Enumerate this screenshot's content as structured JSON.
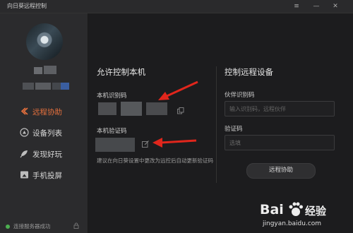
{
  "window": {
    "title": "向日葵远程控制",
    "controls": [
      "≡",
      "—",
      "✕"
    ]
  },
  "sidebar": {
    "items": [
      {
        "label": "远程协助",
        "icon": "remote-assist-icon",
        "active": true
      },
      {
        "label": "设备列表",
        "icon": "device-list-icon",
        "active": false
      },
      {
        "label": "发现好玩",
        "icon": "discover-icon",
        "active": false
      },
      {
        "label": "手机投屏",
        "icon": "screen-cast-icon",
        "active": false
      }
    ],
    "status": "连接服务器成功"
  },
  "allow_control": {
    "title": "允许控制本机",
    "id_label": "本机识别码",
    "code_label": "本机验证码",
    "hint": "建议在向日葵设置中更改为远控后自动更新验证码"
  },
  "remote_control": {
    "title": "控制远程设备",
    "partner_label": "伙伴识别码",
    "partner_placeholder": "输入识别码，远程伙伴",
    "code_label": "验证码",
    "code_placeholder": "选填",
    "button": "远程协助"
  },
  "watermark": {
    "brand_left": "Bai",
    "brand_right": "经验",
    "url": "jingyan.baidu.com"
  },
  "colors": {
    "accent": "#e5703d",
    "arrow": "#e0261c",
    "status_ok": "#4caf50"
  }
}
